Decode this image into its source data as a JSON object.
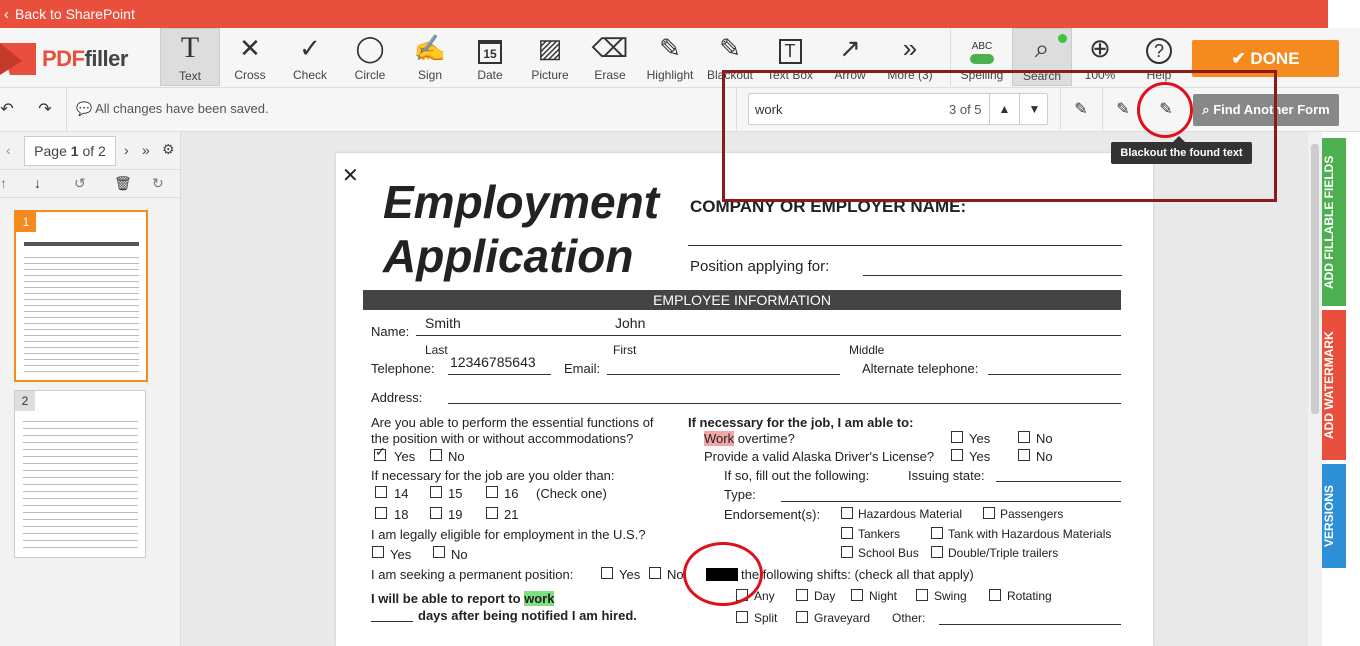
{
  "topbar": {
    "back_label": "Back to SharePoint"
  },
  "logo": {
    "pdf": "PDF",
    "filler": "filler"
  },
  "tools": [
    {
      "label": "Text",
      "icon": "T"
    },
    {
      "label": "Cross",
      "icon": "✕"
    },
    {
      "label": "Check",
      "icon": "✓"
    },
    {
      "label": "Circle",
      "icon": "◯"
    },
    {
      "label": "Sign",
      "icon": "✍"
    },
    {
      "label": "Date",
      "icon": "15"
    },
    {
      "label": "Picture",
      "icon": "▨"
    },
    {
      "label": "Erase",
      "icon": "⌫"
    },
    {
      "label": "Highlight",
      "icon": "✎"
    },
    {
      "label": "Blackout",
      "icon": "✎"
    },
    {
      "label": "Text Box",
      "icon": "T"
    },
    {
      "label": "Arrow",
      "icon": "↗"
    },
    {
      "label": "More (3)",
      "icon": "»"
    },
    {
      "label": "Spelling",
      "icon": "ABC"
    },
    {
      "label": "Search",
      "icon": "⌕"
    },
    {
      "label": "100%",
      "icon": "⊕"
    },
    {
      "label": "Help",
      "icon": "?"
    }
  ],
  "done_label": "DONE",
  "subbar": {
    "saved_text": "All changes have been saved.",
    "search_query": "work",
    "search_count": "3 of 5",
    "find_form_label": "Find Another Form",
    "tooltip": "Blackout the found text"
  },
  "pagenav": {
    "prefix": "Page ",
    "current": "1",
    "suffix": " of 2"
  },
  "thumbs": [
    {
      "num": "1"
    },
    {
      "num": "2"
    }
  ],
  "sidetabs": {
    "fillable": "ADD FILLABLE FIELDS",
    "watermark": "ADD WATERMARK",
    "versions": "VERSIONS"
  },
  "doc": {
    "title1": "Employment",
    "title2": "Application",
    "company": "COMPANY OR EMPLOYER NAME:",
    "position": "Position applying for:",
    "section": "EMPLOYEE INFORMATION",
    "name_label": "Name:",
    "name_last": "Smith",
    "name_first": "John",
    "last": "Last",
    "first": "First",
    "middle": "Middle",
    "telephone": "Telephone:",
    "phone_value": "12346785643",
    "email": "Email:",
    "alt_phone": "Alternate telephone:",
    "address": "Address:",
    "q_essential1": "Are you able to perform the essential functions of",
    "q_essential2": "the position with or without accommodations?",
    "yes": "Yes",
    "no": "No",
    "q_older": "If necessary for the job are you older than:",
    "age14": "14",
    "age15": "15",
    "age16": "16",
    "age18": "18",
    "age19": "19",
    "age21": "21",
    "check_one": "(Check one)",
    "q_eligible": "I am legally eligible for employment in the U.S.?",
    "q_permanent": "I am seeking a permanent position:",
    "q_report1": "I will be able to report to ",
    "q_report_word": "work",
    "q_report2": "days after being notified I am hired.",
    "r_header": "If necessary for the job, I am able to:",
    "r_work": "Work",
    "r_overtime": " overtime?",
    "r_license": "Provide a valid Alaska Driver's License?",
    "r_iffill": "If so, fill out the following:",
    "r_issuing": "Issuing state:",
    "r_type": "Type:",
    "r_endorse": "Endorsement(s):",
    "e_hazmat": "Hazardous Material",
    "e_pass": "Passengers",
    "e_tankers": "Tankers",
    "e_tankhaz": "Tank with Hazardous Materials",
    "e_school": "School Bus",
    "e_double": "Double/Triple trailers",
    "r_shifts": "the following shifts: (check all that apply)",
    "s_any": "Any",
    "s_day": "Day",
    "s_night": "Night",
    "s_swing": "Swing",
    "s_rotating": "Rotating",
    "s_split": "Split",
    "s_graveyard": "Graveyard",
    "s_other": "Other:"
  }
}
